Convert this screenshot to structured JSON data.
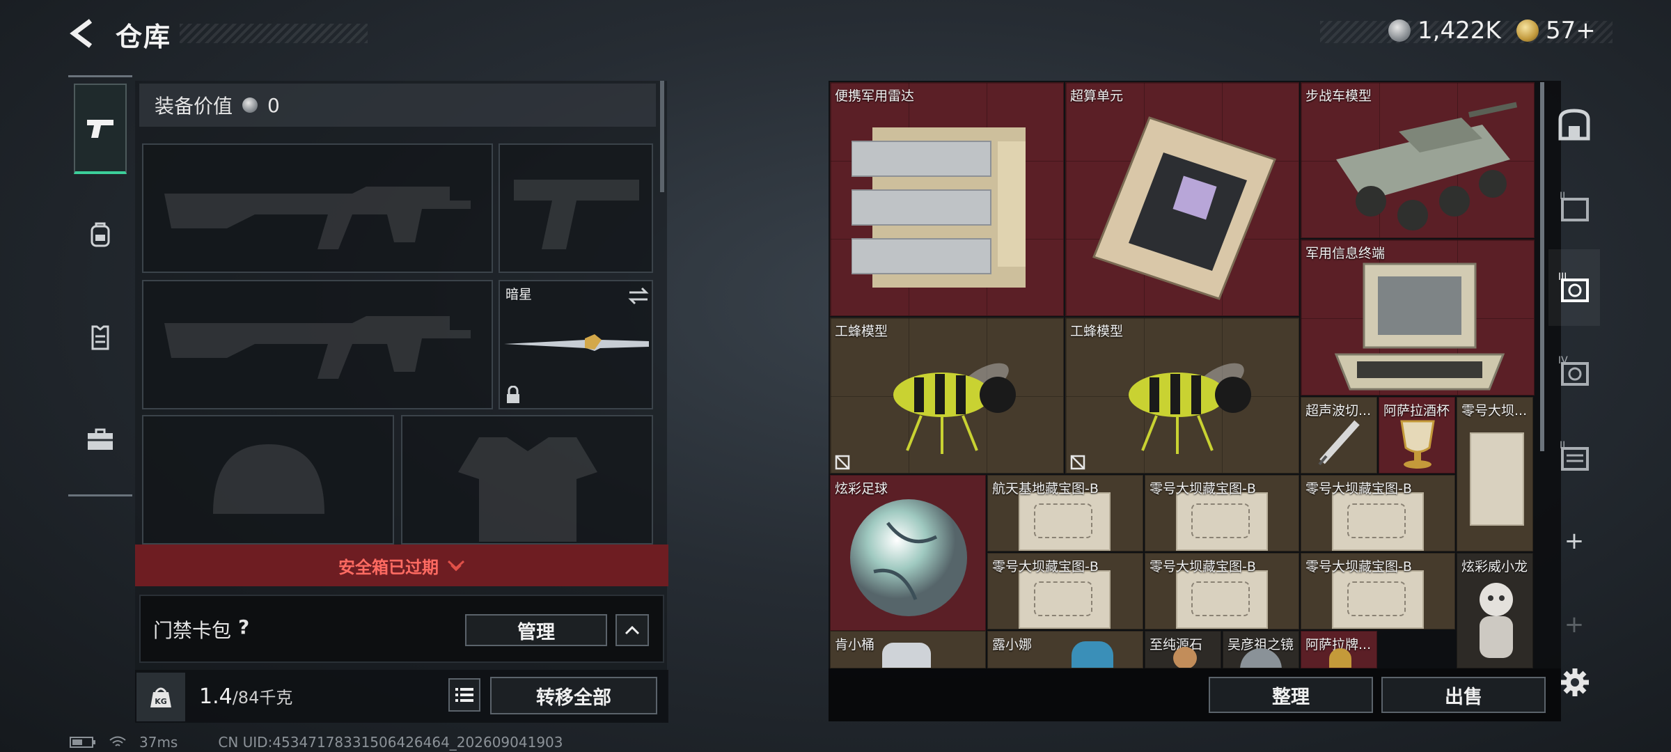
{
  "header": {
    "title": "仓库",
    "currency_silver": "1,422K",
    "currency_gold": "57+"
  },
  "colors": {
    "accent": "#3ccf9a",
    "expired": "#ff6b62",
    "item_red": "#5b1f26",
    "item_brown": "#463b2c"
  },
  "sidebar": {
    "categories": [
      {
        "icon": "pistol-icon",
        "active": true
      },
      {
        "icon": "backpack-icon",
        "active": false
      },
      {
        "icon": "vest-icon",
        "active": false
      },
      {
        "icon": "briefcase-icon",
        "active": false
      }
    ]
  },
  "loadout": {
    "equip_value_label": "装备价值",
    "equip_value": "0",
    "melee_name": "暗星",
    "safebox_status": "安全箱已过期",
    "access_card_label": "门禁卡包",
    "access_help": "?",
    "manage_label": "管理",
    "weight_current": "1.4",
    "weight_max": "/84千克",
    "weight_unit_icon": "KG",
    "transfer_all_label": "转移全部"
  },
  "stash": {
    "items": [
      {
        "name": "便携军用雷达"
      },
      {
        "name": "超算单元"
      },
      {
        "name": "步战车模型"
      },
      {
        "name": "军用信息终端"
      },
      {
        "name": "工蜂模型"
      },
      {
        "name": "工蜂模型"
      },
      {
        "name": "超声波切..."
      },
      {
        "name": "阿萨拉酒杯"
      },
      {
        "name": "零号大坝..."
      },
      {
        "name": "炫彩足球"
      },
      {
        "name": "航天基地藏宝图-B"
      },
      {
        "name": "零号大坝藏宝图-B"
      },
      {
        "name": "零号大坝藏宝图-B"
      },
      {
        "name": "零号大坝藏宝图-B"
      },
      {
        "name": "零号大坝藏宝图-B"
      },
      {
        "name": "零号大坝藏宝图-B"
      },
      {
        "name": "炫彩威小龙"
      },
      {
        "name": "肯小桶"
      },
      {
        "name": "露小娜"
      },
      {
        "name": "至纯源石"
      },
      {
        "name": "吴彦祖之镜"
      },
      {
        "name": "阿萨拉牌..."
      }
    ],
    "sort_label": "整理",
    "sell_label": "出售"
  },
  "right_tabs": [
    {
      "icon": "safe-icon",
      "label": ""
    },
    {
      "icon": "tab-2-icon",
      "label": "II"
    },
    {
      "icon": "tab-3-icon",
      "label": "III"
    },
    {
      "icon": "tab-4-icon",
      "label": "IV"
    },
    {
      "icon": "tab-5-icon",
      "label": "II"
    },
    {
      "icon": "add-icon",
      "label": "+"
    },
    {
      "icon": "add-disabled-icon",
      "label": "+"
    }
  ],
  "status_bar": {
    "ping": "37ms",
    "uid": "CN UID:4534717833150642646​4_202609041903"
  }
}
